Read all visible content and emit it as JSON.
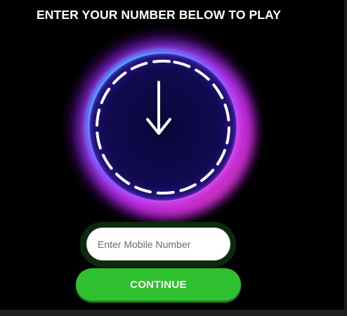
{
  "header": {
    "title": "ENTER YOUR NUMBER BELOW TO PLAY"
  },
  "dial": {
    "icon": "arrow-down-icon",
    "glow_colors": [
      "#2a5bff",
      "#9b2cff",
      "#ff2fd6"
    ],
    "inner_color": "#0a0540"
  },
  "form": {
    "mobile_placeholder": "Enter Mobile Number",
    "mobile_value": "",
    "continue_label": "CONTINUE",
    "accent": "#2fc02f"
  }
}
